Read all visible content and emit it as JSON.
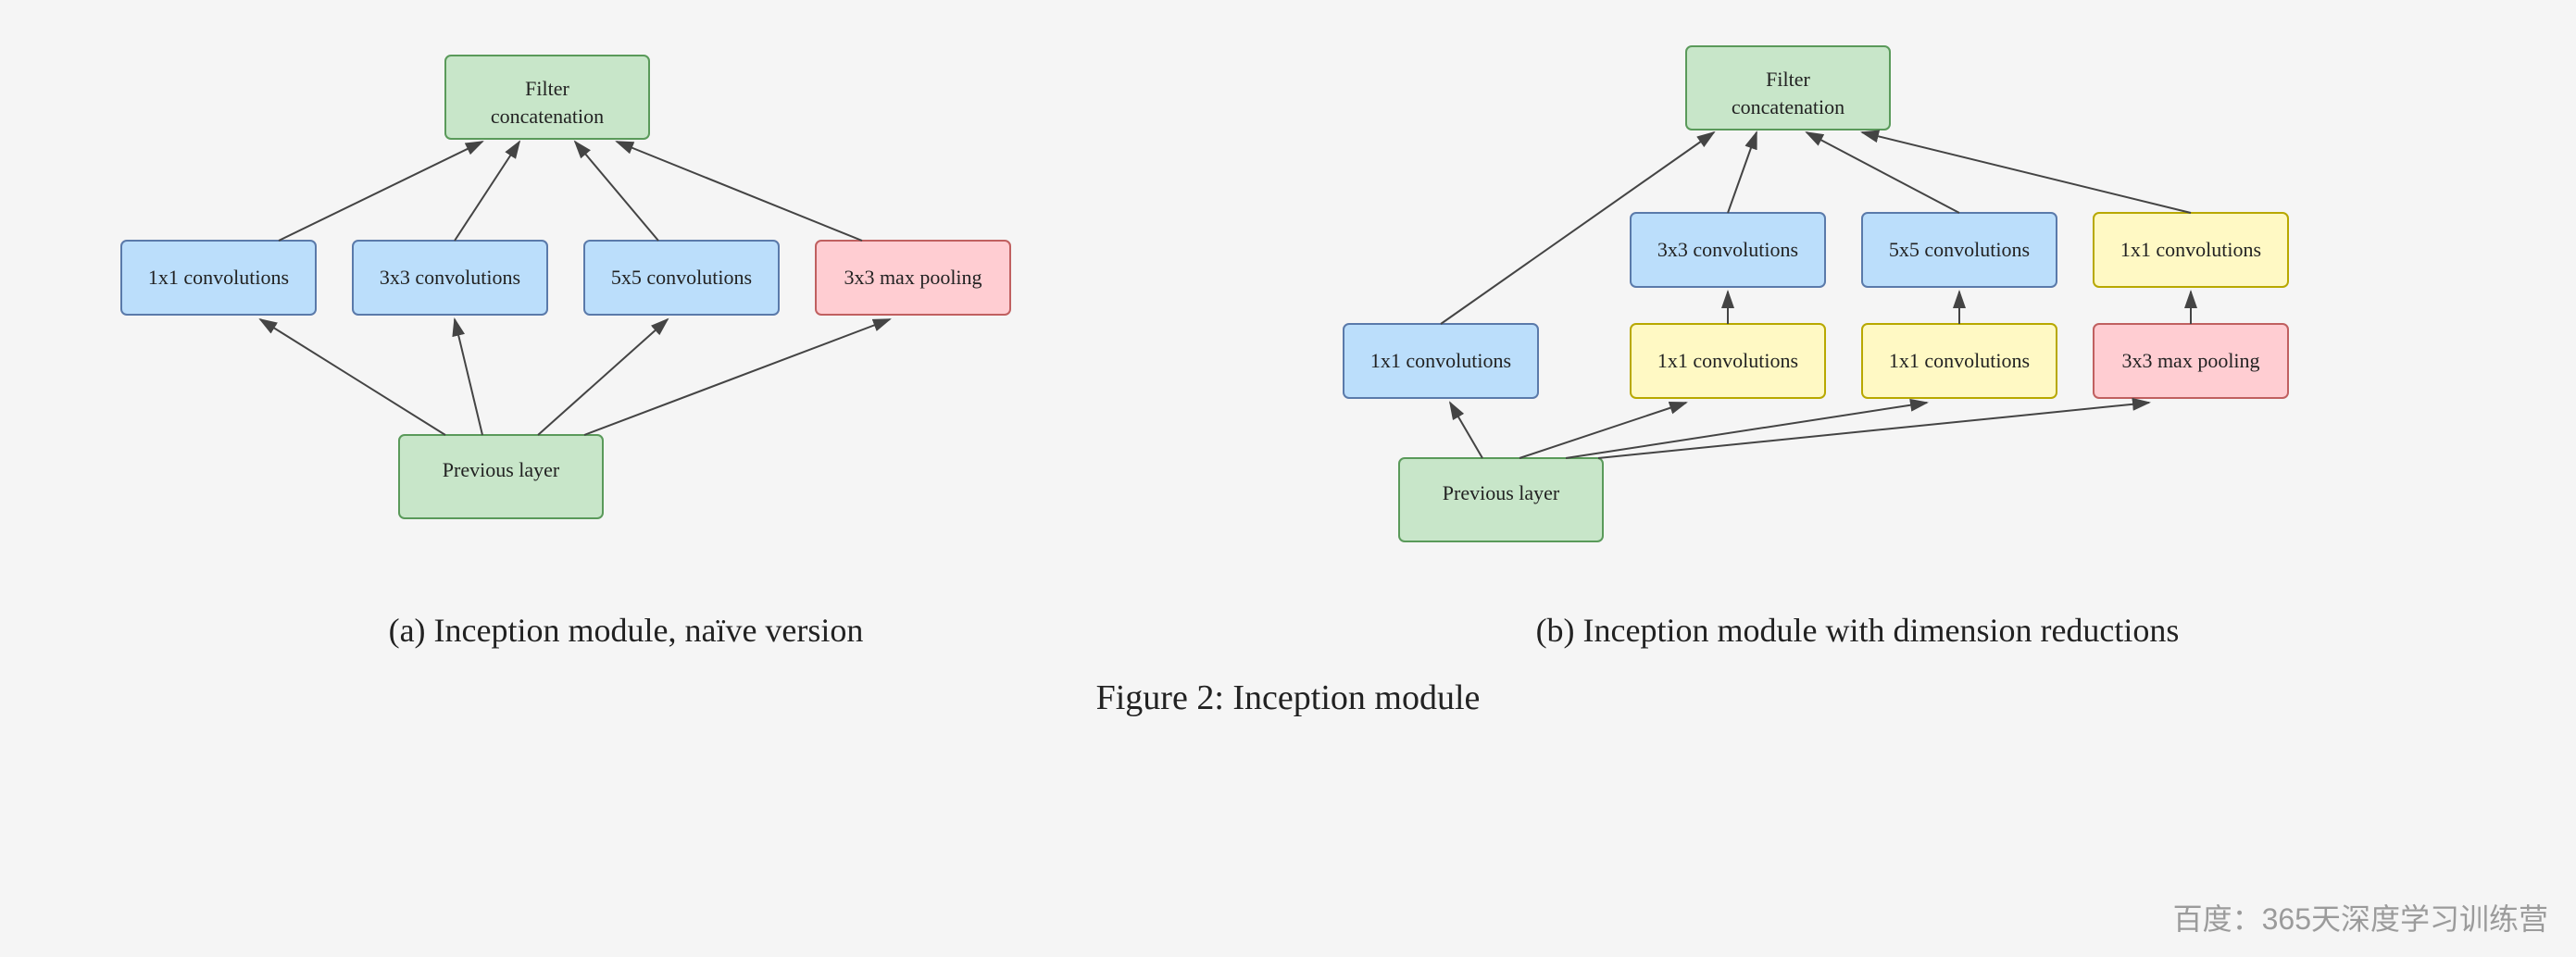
{
  "diagrams": [
    {
      "id": "naive",
      "caption": "(a)  Inception module, naïve version"
    },
    {
      "id": "dimreduction",
      "caption": "(b)  Inception module with dimension reductions"
    }
  ],
  "figure_caption": "Figure 2: Inception module",
  "watermark": "百度：365天深度学习训练营",
  "boxes": {
    "filter_concat": "Filter\nconcatenation",
    "1x1_conv": "1x1 convolutions",
    "3x3_conv": "3x3 convolutions",
    "5x5_conv": "5x5 convolutions",
    "3x3_maxpool": "3x3 max pooling",
    "previous_layer": "Previous layer"
  }
}
